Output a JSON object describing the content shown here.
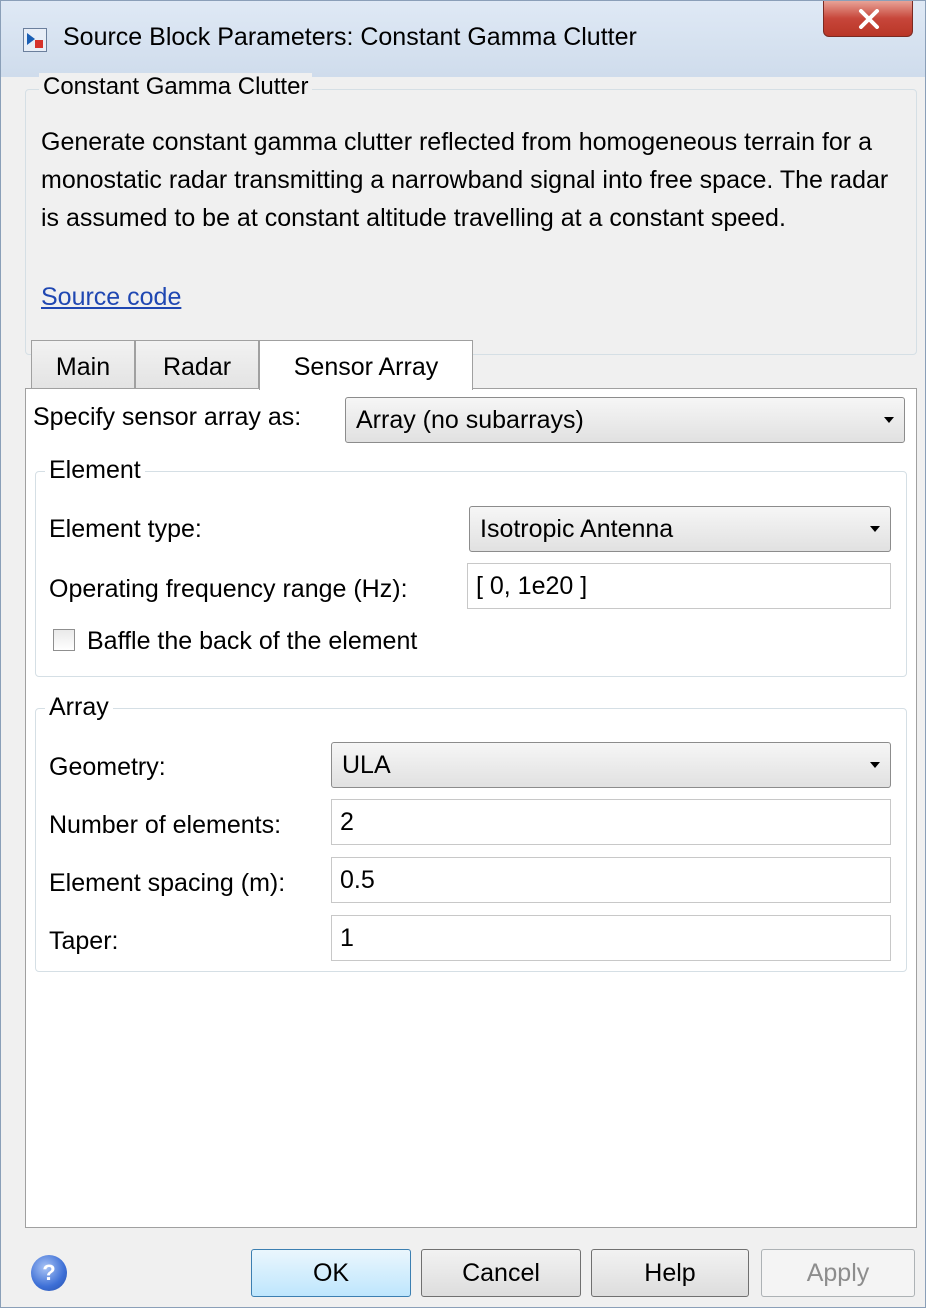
{
  "window": {
    "title": "Source Block Parameters: Constant Gamma Clutter",
    "close_label": "X"
  },
  "description": {
    "heading": "Constant Gamma Clutter",
    "text": "Generate constant gamma clutter reflected from homogeneous terrain for a monostatic radar transmitting a narrowband signal into free space. The radar is assumed to be at constant altitude travelling at a constant speed.",
    "source_link": "Source code"
  },
  "tabs": [
    {
      "label": "Main",
      "active": false
    },
    {
      "label": "Radar",
      "active": false
    },
    {
      "label": "Sensor Array",
      "active": true
    }
  ],
  "sensor_array": {
    "specify_label": "Specify sensor array as:",
    "specify_value": "Array (no subarrays)",
    "element": {
      "legend": "Element",
      "type_label": "Element type:",
      "type_value": "Isotropic Antenna",
      "freq_label": "Operating frequency range (Hz):",
      "freq_value": "[ 0, 1e20 ]",
      "baffle_label": "Baffle the back of the element",
      "baffle_checked": false
    },
    "array": {
      "legend": "Array",
      "geometry_label": "Geometry:",
      "geometry_value": "ULA",
      "num_label": "Number of elements:",
      "num_value": "2",
      "spacing_label": "Element spacing (m):",
      "spacing_value": "0.5",
      "taper_label": "Taper:",
      "taper_value": "1"
    }
  },
  "buttons": {
    "ok": "OK",
    "cancel": "Cancel",
    "help": "Help",
    "apply": "Apply",
    "help_icon_glyph": "?"
  },
  "icons": {
    "title": "simulink-block-icon",
    "help": "help-icon"
  },
  "colors": {
    "link": "#1f47b2",
    "close_button": "#c7463a",
    "default_button": "#bee6fd"
  }
}
